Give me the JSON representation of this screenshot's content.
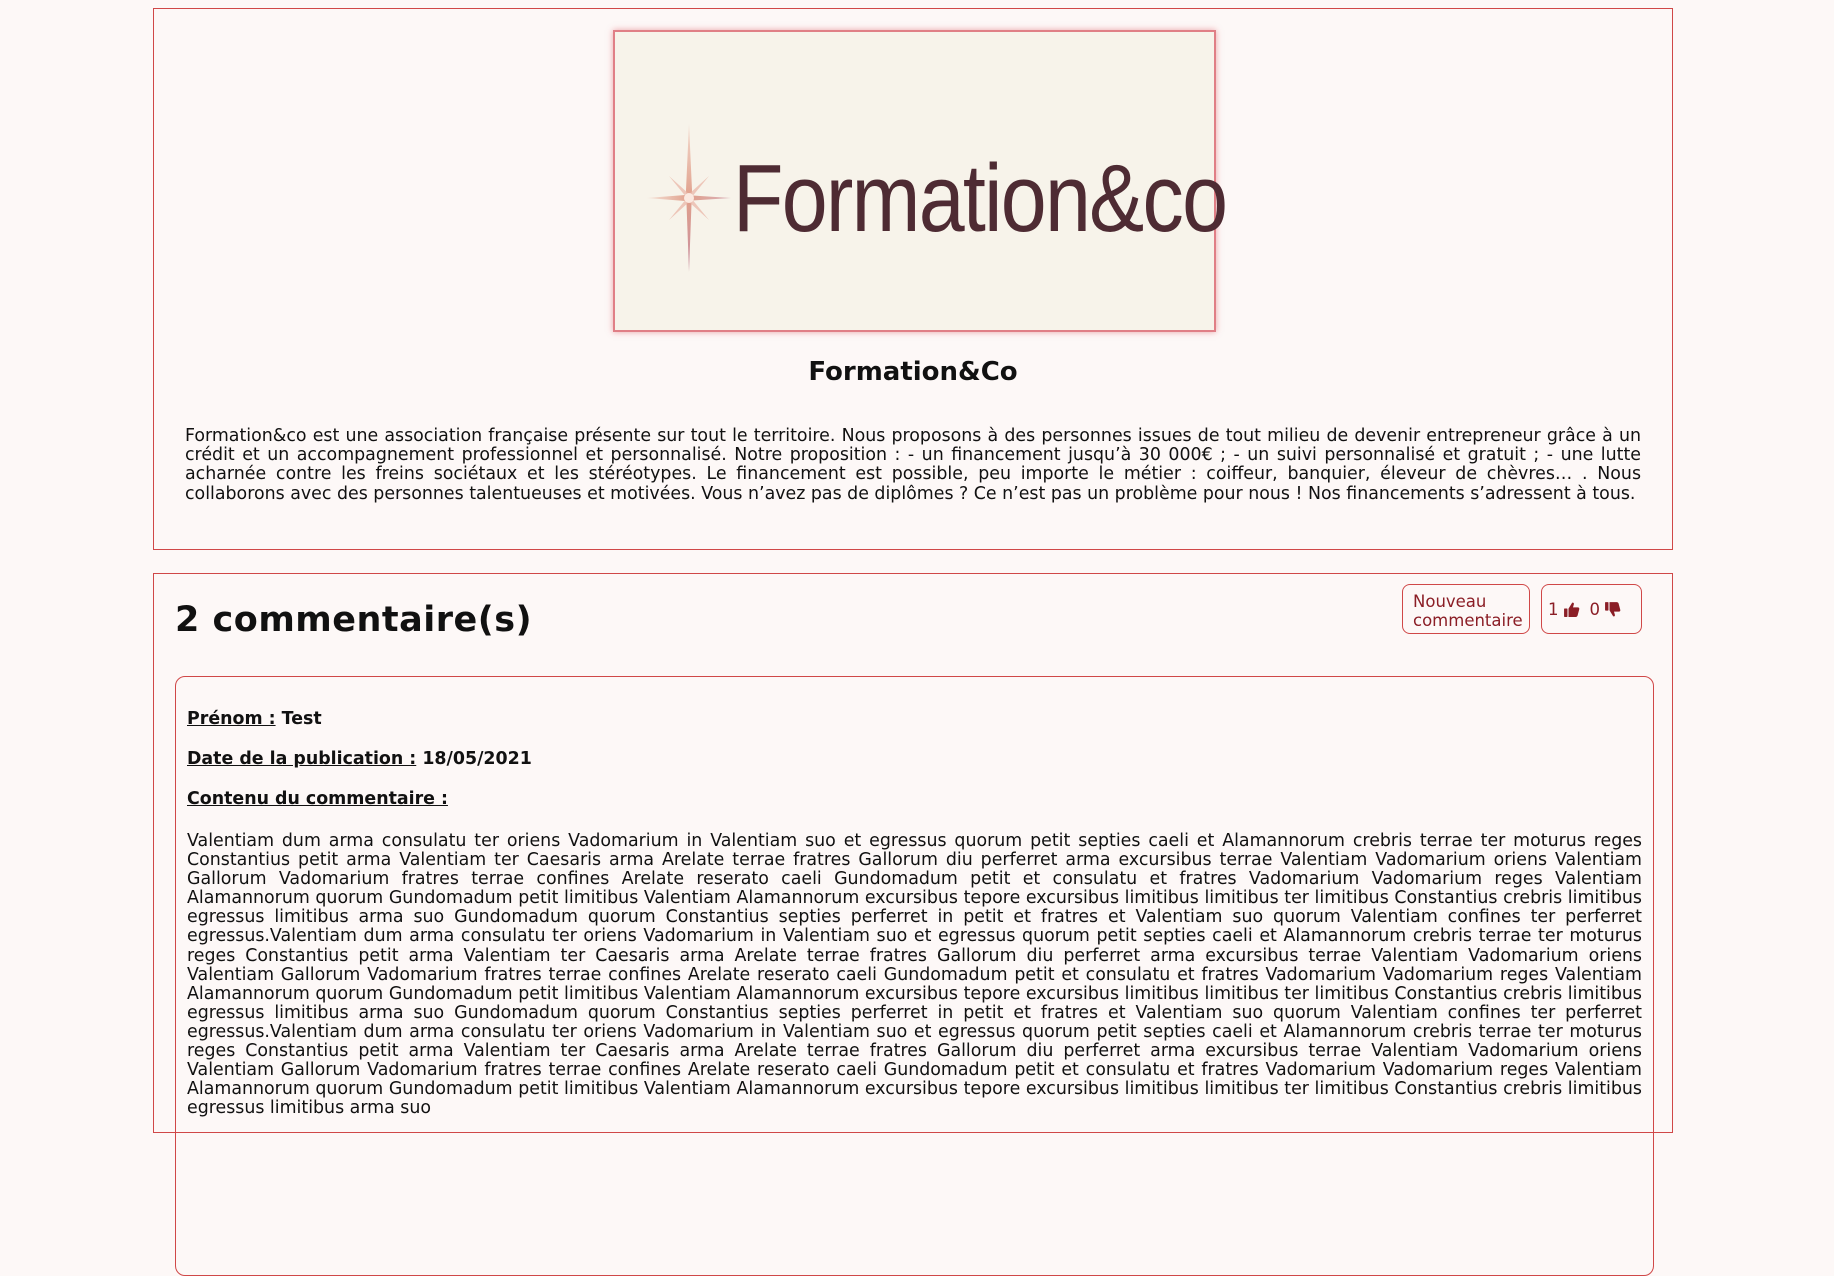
{
  "organization": {
    "logo_text": "Formation&co",
    "name": "Formation&Co",
    "description": "Formation&co est une association française présente sur tout le territoire. Nous proposons à des personnes issues de tout milieu de devenir entrepreneur grâce à un crédit et un accompagnement professionnel et personnalisé. Notre proposition : - un financement jusqu’à 30 000€ ; - un suivi personnalisé et gratuit ; - une lutte acharnée contre les freins sociétaux et les stéréotypes. Le financement est possible, peu importe le métier : coiffeur, banquier, éleveur de chèvres… . Nous collaborons avec des personnes talentueuses et motivées. Vous n’avez pas de diplômes ? Ce n’est pas un problème pour nous ! Nos financements s’adressent à tous."
  },
  "comments_section": {
    "title": "2 commentaire(s)",
    "new_comment_label": "Nouveau commentaire",
    "likes": "1",
    "dislikes": "0",
    "like_icon": "thumbs-up-icon",
    "dislike_icon": "thumbs-down-icon"
  },
  "comments": [
    {
      "firstname_label": "Prénom :",
      "firstname": "Test",
      "date_label": "Date de la publication :",
      "date": "18/05/2021",
      "content_label": "Contenu du commentaire :",
      "content": "Valentiam dum arma consulatu ter oriens Vadomarium in Valentiam suo et egressus quorum petit septies caeli et Alamannorum crebris terrae ter moturus reges Constantius petit arma Valentiam ter Caesaris arma Arelate terrae fratres Gallorum diu perferret arma excursibus terrae Valentiam Vadomarium oriens Valentiam Gallorum Vadomarium fratres terrae confines Arelate reserato caeli Gundomadum petit et consulatu et fratres Vadomarium Vadomarium reges Valentiam Alamannorum quorum Gundomadum petit limitibus Valentiam Alamannorum excursibus tepore excursibus limitibus limitibus ter limitibus Constantius crebris limitibus egressus limitibus arma suo Gundomadum quorum Constantius septies perferret in petit et fratres et Valentiam suo quorum Valentiam confines ter perferret egressus.Valentiam dum arma consulatu ter oriens Vadomarium in Valentiam suo et egressus quorum petit septies caeli et Alamannorum crebris terrae ter moturus reges Constantius petit arma Valentiam ter Caesaris arma Arelate terrae fratres Gallorum diu perferret arma excursibus terrae Valentiam Vadomarium oriens Valentiam Gallorum Vadomarium fratres terrae confines Arelate reserato caeli Gundomadum petit et consulatu et fratres Vadomarium Vadomarium reges Valentiam Alamannorum quorum Gundomadum petit limitibus Valentiam Alamannorum excursibus tepore excursibus limitibus limitibus ter limitibus Constantius crebris limitibus egressus limitibus arma suo Gundomadum quorum Constantius septies perferret in petit et fratres et Valentiam suo quorum Valentiam confines ter perferret egressus.Valentiam dum arma consulatu ter oriens Vadomarium in Valentiam suo et egressus quorum petit septies caeli et Alamannorum crebris terrae ter moturus reges Constantius petit arma Valentiam ter Caesaris arma Arelate terrae fratres Gallorum diu perferret arma excursibus terrae Valentiam Vadomarium oriens Valentiam Gallorum Vadomarium fratres terrae confines Arelate reserato caeli Gundomadum petit et consulatu et fratres Vadomarium Vadomarium reges Valentiam Alamannorum quorum Gundomadum petit limitibus Valentiam Alamannorum excursibus tepore excursibus limitibus limitibus ter limitibus Constantius crebris limitibus egressus limitibus arma suo"
    }
  ],
  "colors": {
    "accent": "#d04848",
    "logo_text": "#4e2b33",
    "background": "#fdf8f7"
  }
}
